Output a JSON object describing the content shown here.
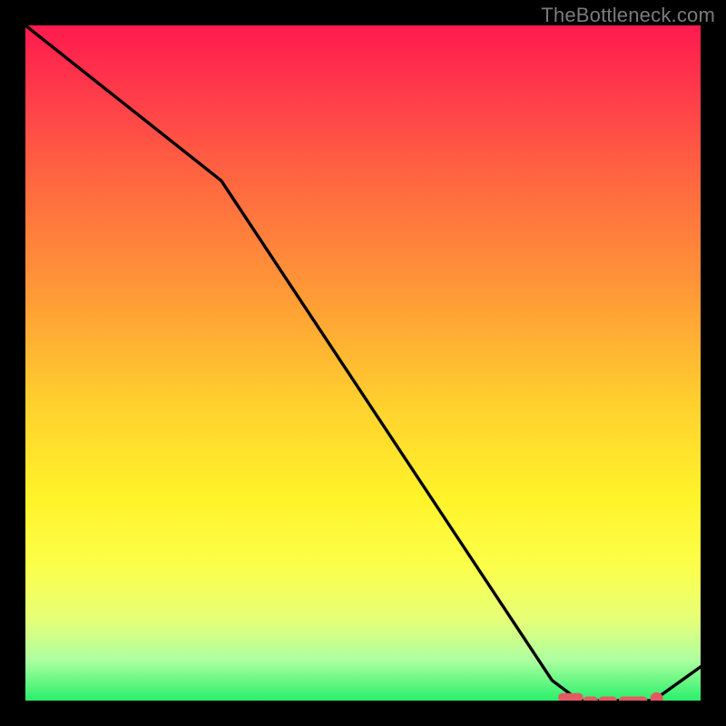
{
  "watermark": "TheBottleneck.com",
  "chart_data": {
    "type": "line",
    "title": "",
    "xlabel": "",
    "ylabel": "",
    "xlim": [
      0,
      100
    ],
    "ylim": [
      0,
      100
    ],
    "series": [
      {
        "name": "bottleneck-curve",
        "x": [
          0,
          29,
          78,
          82,
          93,
          100
        ],
        "values": [
          100,
          77,
          3,
          0,
          0,
          5
        ]
      }
    ],
    "annotations": {
      "optimal_range_dashes": [
        {
          "x0": 79.5,
          "x1": 82.0,
          "y": 0.5
        },
        {
          "x0": 83.2,
          "x1": 84.2,
          "y": 0.0
        },
        {
          "x0": 85.5,
          "x1": 87.0,
          "y": 0.0
        },
        {
          "x0": 88.5,
          "x1": 91.5,
          "y": 0.0
        }
      ],
      "marker_point": {
        "x": 93.5,
        "y": 0.3
      }
    },
    "gradient_stops": [
      {
        "pct": 0,
        "color": "#ff1a4e"
      },
      {
        "pct": 70,
        "color": "#fff32a"
      },
      {
        "pct": 100,
        "color": "#29f06a"
      }
    ]
  }
}
